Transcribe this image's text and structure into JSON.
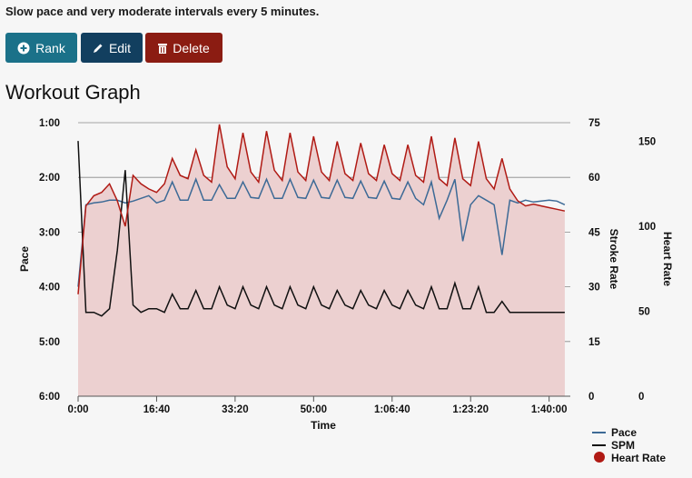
{
  "description": "Slow pace and very moderate intervals every 5 minutes.",
  "buttons": {
    "rank": {
      "label": "Rank",
      "icon": "plus-circle-icon",
      "color": "#1b7189"
    },
    "edit": {
      "label": "Edit",
      "icon": "pencil-icon",
      "color": "#123f5f"
    },
    "delete": {
      "label": "Delete",
      "icon": "trash-icon",
      "color": "#8b1c12"
    }
  },
  "heading": "Workout Graph",
  "chart_data": {
    "type": "line",
    "xlabel": "Time",
    "x_unit": "seconds",
    "x": [
      0,
      100,
      200,
      300,
      400,
      500,
      600,
      700,
      800,
      900,
      1000,
      1100,
      1200,
      1300,
      1400,
      1500,
      1600,
      1700,
      1800,
      1900,
      2000,
      2100,
      2200,
      2300,
      2400,
      2500,
      2600,
      2700,
      2800,
      2900,
      3000,
      3100,
      3200,
      3300,
      3400,
      3500,
      3600,
      3700,
      3800,
      3900,
      4000,
      4100,
      4200,
      4300,
      4400,
      4500,
      4600,
      4700,
      4800,
      4900,
      5000,
      5100,
      5200,
      5300,
      5400,
      5500,
      5600,
      5700,
      5800,
      5900,
      6000,
      6100,
      6200
    ],
    "x_ticks": [
      "0:00",
      "16:40",
      "33:20",
      "50:00",
      "1:06:40",
      "1:23:20",
      "1:40:00"
    ],
    "x_tick_values": [
      0,
      1000,
      2000,
      3000,
      4000,
      5000,
      6000
    ],
    "xlim": [
      0,
      6270
    ],
    "axes": {
      "pace": {
        "label": "Pace",
        "unit": "seconds per 500m",
        "ticks": [
          "1:00",
          "2:00",
          "3:00",
          "4:00",
          "5:00",
          "6:00"
        ],
        "range": [
          60,
          360
        ],
        "inverted": true
      },
      "spm": {
        "label": "Stroke Rate",
        "ticks": [
          "75",
          "60",
          "45",
          "30",
          "15",
          "0"
        ],
        "range": [
          0,
          75
        ]
      },
      "hr": {
        "label": "Heart Rate",
        "ticks": [
          "150",
          "100",
          "50",
          "0"
        ],
        "range": [
          0,
          161
        ]
      }
    },
    "grid": true,
    "legend_position": "bottom-right",
    "series": [
      {
        "name": "Pace",
        "axis": "pace",
        "color": "#3d6a96",
        "values": [
          240,
          150,
          148,
          147,
          145,
          145,
          148,
          146,
          143,
          140,
          148,
          145,
          125,
          145,
          145,
          122,
          145,
          145,
          128,
          143,
          143,
          125,
          142,
          143,
          122,
          143,
          143,
          122,
          142,
          143,
          123,
          142,
          143,
          123,
          142,
          143,
          124,
          142,
          143,
          124,
          143,
          144,
          125,
          143,
          150,
          125,
          165,
          145,
          122,
          190,
          150,
          140,
          145,
          150,
          205,
          145,
          148,
          145,
          147,
          146,
          145,
          146,
          150
        ]
      },
      {
        "name": "SPM",
        "axis": "spm",
        "color": "#111111",
        "values": [
          70,
          23,
          23,
          22,
          24,
          40,
          62,
          25,
          23,
          24,
          24,
          23,
          28,
          24,
          24,
          29,
          24,
          24,
          30,
          25,
          24,
          30,
          25,
          24,
          30,
          25,
          24,
          30,
          25,
          24,
          30,
          25,
          24,
          29,
          25,
          24,
          29,
          25,
          24,
          29,
          25,
          24,
          29,
          25,
          24,
          30,
          24,
          24,
          31,
          24,
          24,
          30,
          23,
          23,
          26,
          23,
          23,
          23,
          23,
          23,
          23,
          23,
          23
        ]
      },
      {
        "name": "Heart Rate",
        "axis": "hr",
        "color": "#b01a14",
        "fill": "#ecd0d0",
        "values": [
          60,
          112,
          118,
          120,
          125,
          115,
          100,
          130,
          125,
          122,
          120,
          125,
          140,
          130,
          128,
          145,
          130,
          126,
          160,
          135,
          128,
          155,
          132,
          126,
          156,
          133,
          127,
          155,
          132,
          127,
          153,
          132,
          127,
          150,
          131,
          127,
          149,
          131,
          127,
          148,
          131,
          127,
          148,
          130,
          126,
          153,
          128,
          124,
          152,
          128,
          124,
          150,
          128,
          122,
          140,
          122,
          115,
          112,
          113,
          112,
          111,
          110,
          109
        ]
      }
    ]
  }
}
